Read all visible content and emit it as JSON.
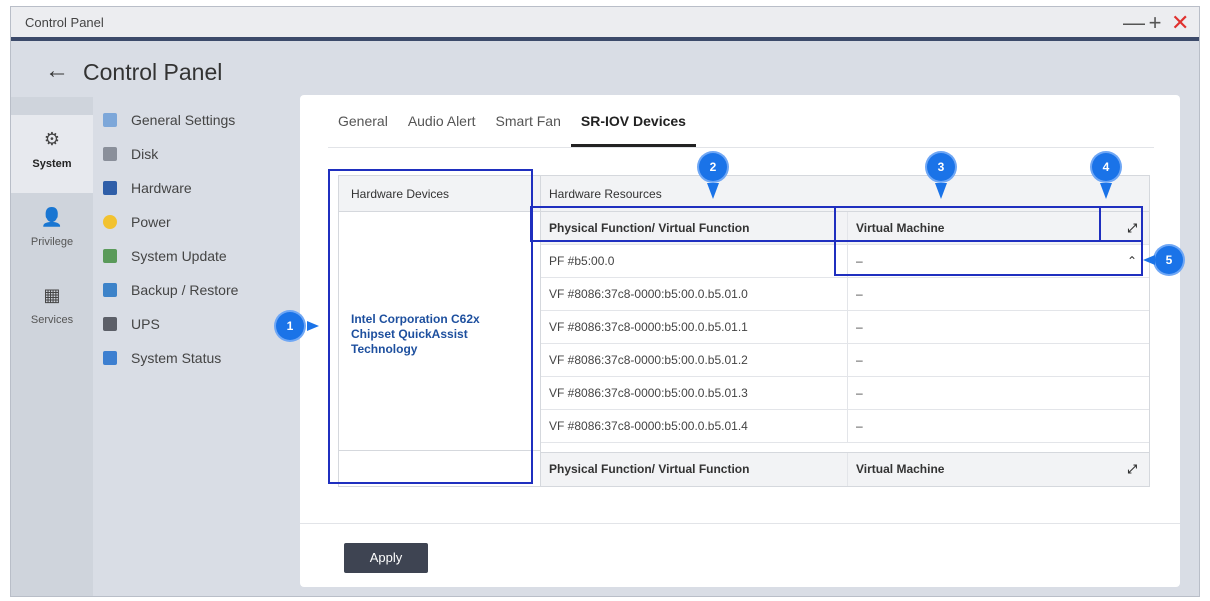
{
  "window": {
    "title": "Control Panel",
    "minimize": "—",
    "maximize": "+",
    "close": "✕"
  },
  "header": {
    "back": "←",
    "title": "Control Panel"
  },
  "rail": [
    {
      "label": "System",
      "icon": "⚙"
    },
    {
      "label": "Privilege",
      "icon": "👤"
    },
    {
      "label": "Services",
      "icon": "▦"
    }
  ],
  "submenu": [
    {
      "label": "General Settings",
      "color": "#7da7d9"
    },
    {
      "label": "Disk",
      "color": "#8a8f9a"
    },
    {
      "label": "Hardware",
      "color": "#2f5ea8"
    },
    {
      "label": "Power",
      "color": "#f2c230"
    },
    {
      "label": "System Update",
      "color": "#5a9a5a"
    },
    {
      "label": "Backup / Restore",
      "color": "#3d83c9"
    },
    {
      "label": "UPS",
      "color": "#5c5f68"
    },
    {
      "label": "System Status",
      "color": "#3d7fd0"
    }
  ],
  "tabs": [
    "General",
    "Audio Alert",
    "Smart Fan",
    "SR-IOV Devices"
  ],
  "table": {
    "hw_header": "Hardware Devices",
    "res_header": "Hardware Resources",
    "device_name": "Intel Corporation C62x Chipset QuickAssist Technology",
    "col_pf": "Physical Function/ Virtual Function",
    "col_vm": "Virtual Machine",
    "expand_icon": "⤢",
    "collapse_icon": "⌃",
    "rows": [
      {
        "pf": "PF #b5:00.0",
        "vm": "–"
      },
      {
        "pf": "VF #8086:37c8-0000:b5:00.0.b5.01.0",
        "vm": "–"
      },
      {
        "pf": "VF #8086:37c8-0000:b5:00.0.b5.01.1",
        "vm": "–"
      },
      {
        "pf": "VF #8086:37c8-0000:b5:00.0.b5.01.2",
        "vm": "–"
      },
      {
        "pf": "VF #8086:37c8-0000:b5:00.0.b5.01.3",
        "vm": "–"
      },
      {
        "pf": "VF #8086:37c8-0000:b5:00.0.b5.01.4",
        "vm": "–"
      }
    ]
  },
  "apply_label": "Apply",
  "callouts": [
    "1",
    "2",
    "3",
    "4",
    "5"
  ],
  "colors": {
    "callout": "#1a73e8",
    "highlight": "#1f2fbf",
    "link": "#1d4f9e"
  }
}
